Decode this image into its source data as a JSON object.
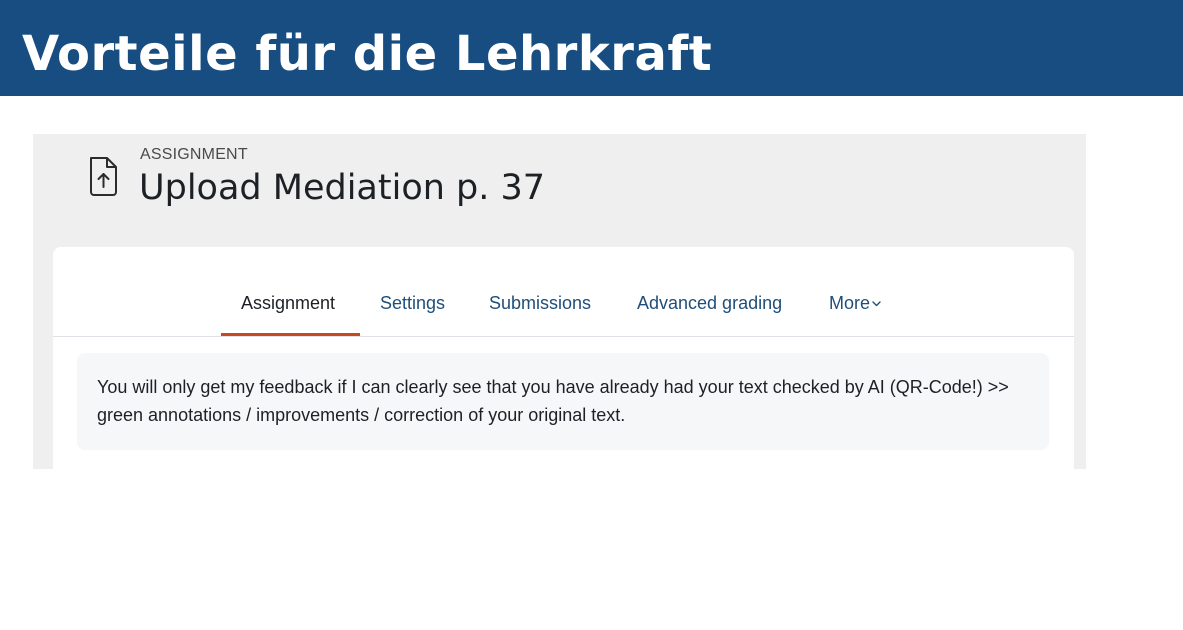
{
  "slide": {
    "title": "Vorteile für die Lehrkraft"
  },
  "assignment": {
    "kicker": "ASSIGNMENT",
    "title": "Upload Mediation p. 37",
    "icon": "file-upload-icon"
  },
  "tabs": [
    {
      "label": "Assignment",
      "active": true
    },
    {
      "label": "Settings",
      "active": false
    },
    {
      "label": "Submissions",
      "active": false
    },
    {
      "label": "Advanced grading",
      "active": false
    },
    {
      "label": "More",
      "active": false,
      "icon": "chevron-down-icon"
    }
  ],
  "note": {
    "text": "You will only get my feedback if I can clearly see that you have already had your text checked by AI (QR-Code!) >> green annotations / improvements / correction of your original text."
  },
  "colors": {
    "header_bg": "#174d80",
    "tab_link": "#1f4e7a",
    "active_underline": "#c8491b",
    "panel_bg": "#efefef"
  }
}
